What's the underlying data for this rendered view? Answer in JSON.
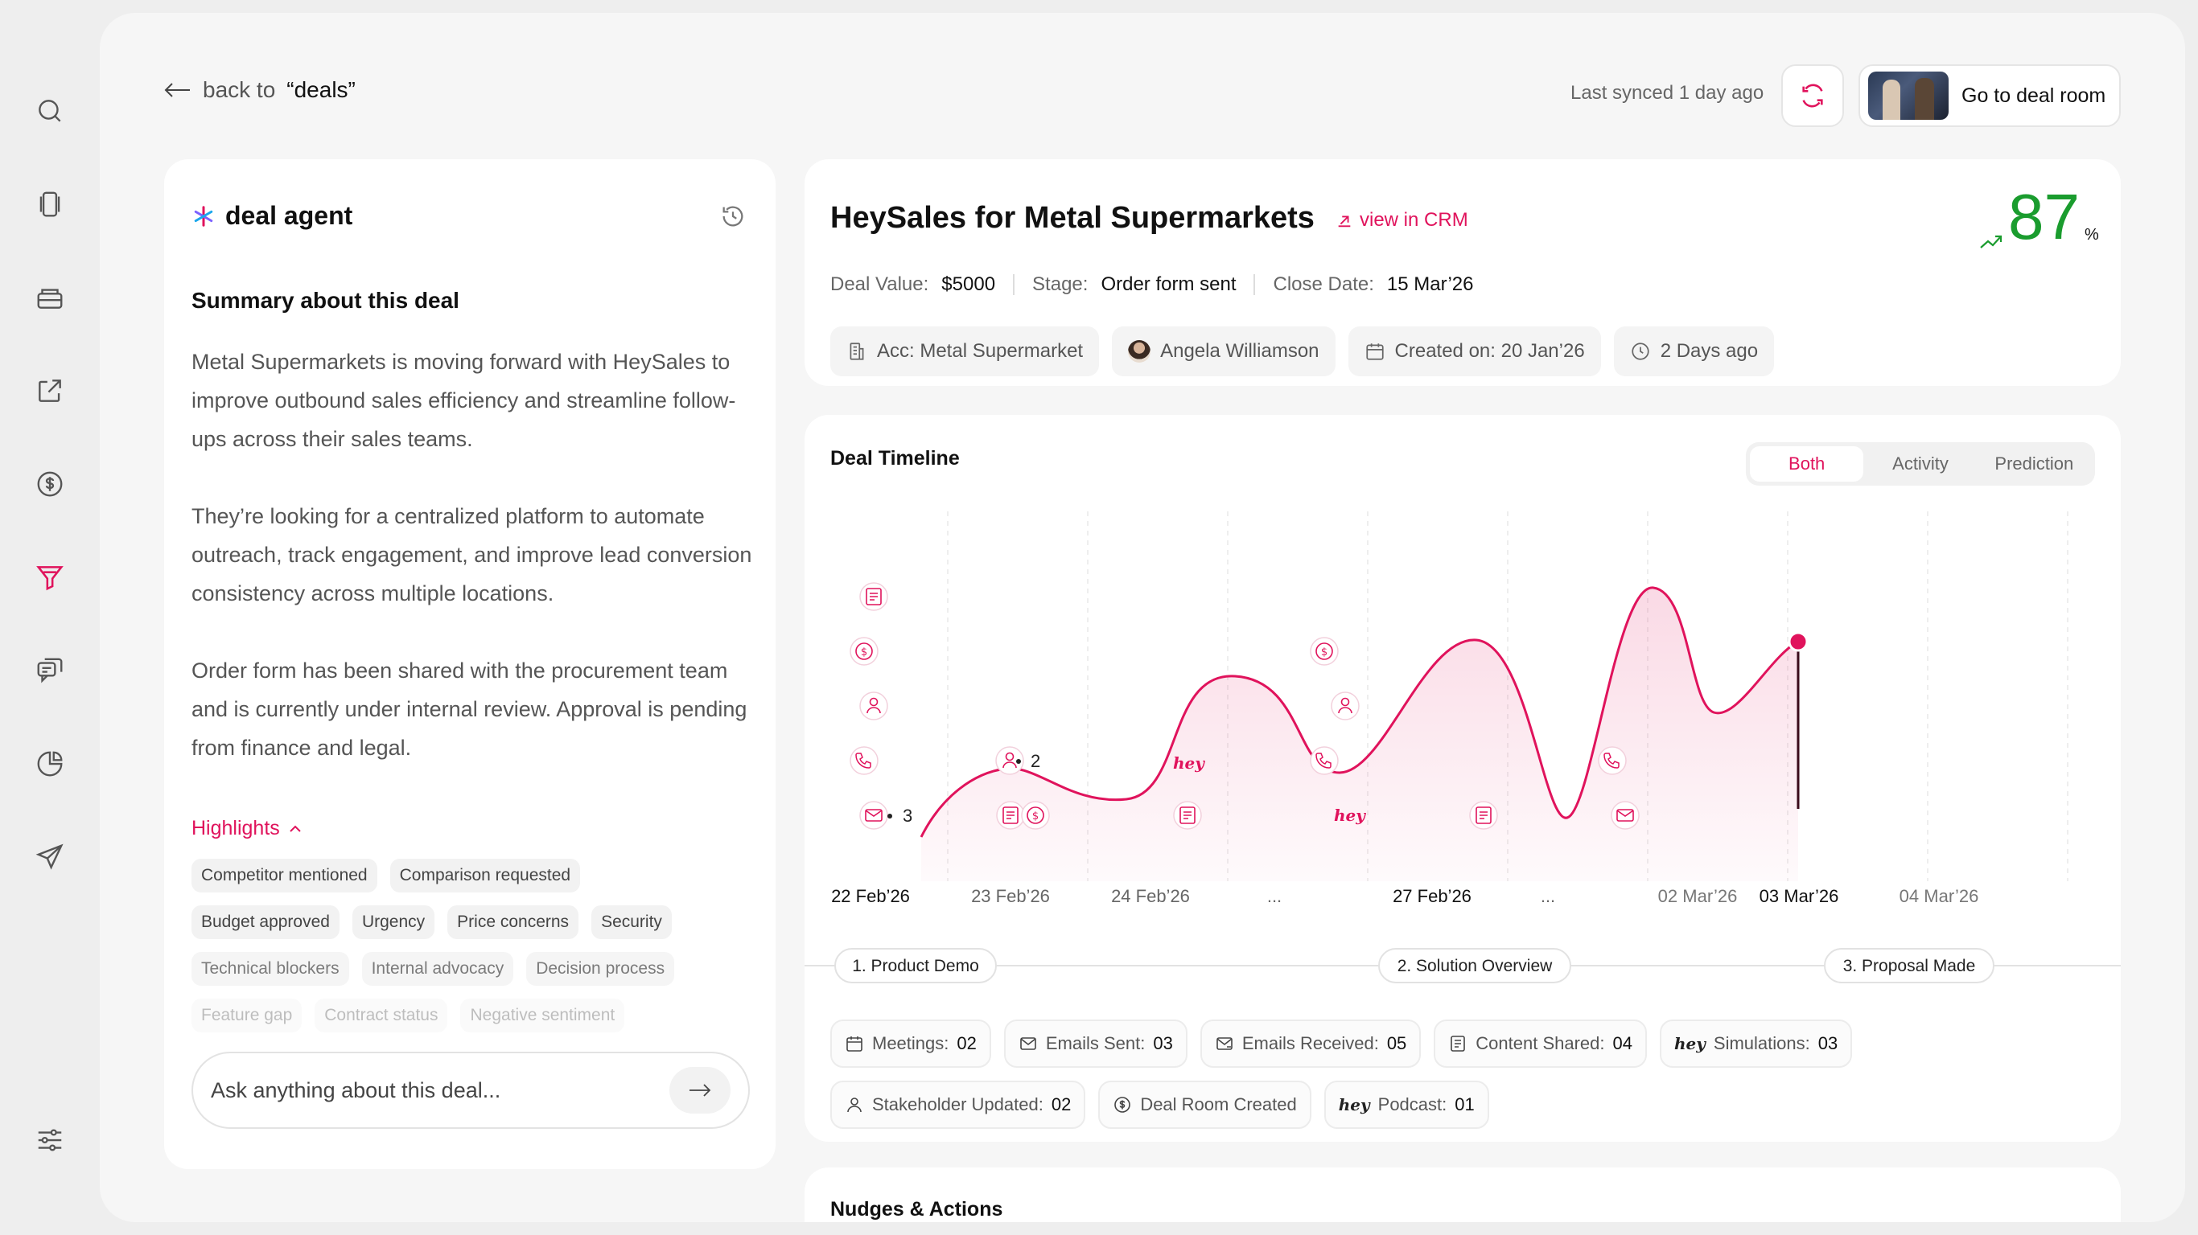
{
  "back": {
    "prefix": "back to",
    "target": "“deals”"
  },
  "sync": {
    "text": "Last synced 1 day ago"
  },
  "deal_room": {
    "label": "Go to deal room"
  },
  "agent": {
    "title": "deal agent",
    "summary_title": "Summary about this deal",
    "paragraphs": [
      "Metal Supermarkets is moving forward with HeySales to improve outbound sales efficiency and streamline follow-ups across their sales teams.",
      "They’re looking for a centralized platform to automate outreach, track engagement, and improve lead conversion consistency across multiple locations.",
      "Order form has been shared with the procurement team and is currently under internal review. Approval is pending from finance and legal."
    ],
    "highlights_label": "Highlights",
    "tags": [
      [
        "Competitor mentioned",
        "Comparison requested"
      ],
      [
        "Budget approved",
        "Urgency",
        "Price concerns",
        "Security"
      ],
      [
        "Technical blockers",
        "Internal advocacy",
        "Decision process"
      ],
      [
        "Feature gap",
        "Contract status",
        "Negative sentiment"
      ]
    ],
    "ask_placeholder": "Ask anything about this deal..."
  },
  "deal": {
    "title": "HeySales for Metal Supermarkets",
    "crm_link": "view in CRM",
    "score": "87",
    "score_unit": "%",
    "value_label": "Deal Value:",
    "value": "$5000",
    "stage_label": "Stage:",
    "stage": "Order form sent",
    "close_label": "Close Date:",
    "close": "15 Mar’26",
    "chips": {
      "account": "Acc: Metal Supermarket",
      "owner": "Angela Williamson",
      "created": "Created on: 20 Jan’26",
      "ago": "2 Days ago"
    }
  },
  "timeline": {
    "title": "Deal Timeline",
    "toggle": [
      "Both",
      "Activity",
      "Prediction"
    ],
    "active_toggle": "Both",
    "dates": [
      "22 Feb’26",
      "23 Feb’26",
      "24 Feb’26",
      "...",
      "27 Feb’26",
      "...",
      "02 Mar’26",
      "03 Mar’26",
      "04 Mar’26"
    ],
    "active_date": "03 Mar’26",
    "stages": [
      "1. Product Demo",
      "2. Solution Overview",
      "3. Proposal Made"
    ],
    "event_counts": {
      "email_22feb": "3",
      "person_24feb": "2"
    },
    "hey_mark": "hey",
    "stats": [
      [
        {
          "label": "Meetings:",
          "value": "02",
          "icon": "calendar-icon"
        },
        {
          "label": "Emails Sent:",
          "value": "03",
          "icon": "mail-sent-icon"
        },
        {
          "label": "Emails Received:",
          "value": "05",
          "icon": "mail-received-icon"
        },
        {
          "label": "Content Shared:",
          "value": "04",
          "icon": "document-icon"
        },
        {
          "label": "Simulations:",
          "value": "03",
          "icon": "hey-icon"
        }
      ],
      [
        {
          "label": "Stakeholder Updated:",
          "value": "02",
          "icon": "person-icon"
        },
        {
          "label": "Deal Room Created",
          "value": "",
          "icon": "dollar-icon"
        },
        {
          "label": "Podcast:",
          "value": "01",
          "icon": "hey-icon"
        }
      ]
    ]
  },
  "nudges": {
    "title": "Nudges & Actions"
  },
  "colors": {
    "accent": "#e0135c",
    "score": "#1a9c2e"
  }
}
